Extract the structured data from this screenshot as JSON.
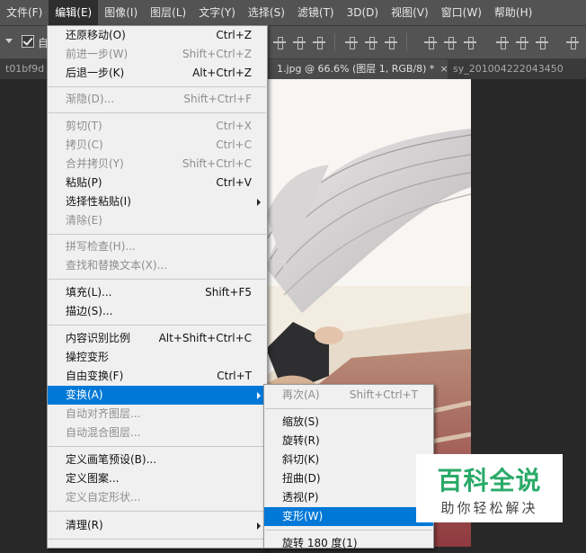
{
  "menubar": {
    "items": [
      "文件(F)",
      "编辑(E)",
      "图像(I)",
      "图层(L)",
      "文字(Y)",
      "选择(S)",
      "滤镜(T)",
      "3D(D)",
      "视图(V)",
      "窗口(W)",
      "帮助(H)"
    ],
    "active_index": 1
  },
  "options_bar": {
    "checkbox_label": "自"
  },
  "tabs": [
    {
      "label": "t01bf9d"
    },
    {
      "label": "1.jpg @ 66.6% (图层 1, RGB/8) *",
      "close": "×"
    },
    {
      "label": "sy_201004222043450"
    }
  ],
  "edit_menu": {
    "items": [
      {
        "label": "还原移动(O)",
        "shortcut": "Ctrl+Z",
        "disabled": false
      },
      {
        "label": "前进一步(W)",
        "shortcut": "Shift+Ctrl+Z",
        "disabled": true
      },
      {
        "label": "后退一步(K)",
        "shortcut": "Alt+Ctrl+Z",
        "disabled": false
      },
      {
        "label": "渐隐(D)...",
        "shortcut": "Shift+Ctrl+F",
        "disabled": true
      },
      {
        "label": "剪切(T)",
        "shortcut": "Ctrl+X",
        "disabled": true
      },
      {
        "label": "拷贝(C)",
        "shortcut": "Ctrl+C",
        "disabled": true
      },
      {
        "label": "合并拷贝(Y)",
        "shortcut": "Shift+Ctrl+C",
        "disabled": true
      },
      {
        "label": "粘贴(P)",
        "shortcut": "Ctrl+V",
        "disabled": false
      },
      {
        "label": "选择性粘贴(I)",
        "shortcut": "",
        "disabled": false,
        "submenu": true
      },
      {
        "label": "清除(E)",
        "shortcut": "",
        "disabled": true
      },
      {
        "label": "拼写检查(H)...",
        "shortcut": "",
        "disabled": true
      },
      {
        "label": "查找和替换文本(X)...",
        "shortcut": "",
        "disabled": true
      },
      {
        "label": "填充(L)...",
        "shortcut": "Shift+F5",
        "disabled": false
      },
      {
        "label": "描边(S)...",
        "shortcut": "",
        "disabled": false
      },
      {
        "label": "内容识别比例",
        "shortcut": "Alt+Shift+Ctrl+C",
        "disabled": false
      },
      {
        "label": "操控变形",
        "shortcut": "",
        "disabled": false
      },
      {
        "label": "自由变换(F)",
        "shortcut": "Ctrl+T",
        "disabled": false
      },
      {
        "label": "变换(A)",
        "shortcut": "",
        "disabled": false,
        "submenu": true,
        "highlighted": true
      },
      {
        "label": "自动对齐图层...",
        "shortcut": "",
        "disabled": true
      },
      {
        "label": "自动混合图层...",
        "shortcut": "",
        "disabled": true
      },
      {
        "label": "定义画笔预设(B)...",
        "shortcut": "",
        "disabled": false
      },
      {
        "label": "定义图案...",
        "shortcut": "",
        "disabled": false
      },
      {
        "label": "定义自定形状...",
        "shortcut": "",
        "disabled": true
      },
      {
        "label": "清理(R)",
        "shortcut": "",
        "disabled": false,
        "submenu": true
      }
    ]
  },
  "transform_menu": {
    "items": [
      {
        "label": "再次(A)",
        "shortcut": "Shift+Ctrl+T",
        "disabled": true
      },
      {
        "label": "缩放(S)",
        "shortcut": "",
        "disabled": false
      },
      {
        "label": "旋转(R)",
        "shortcut": "",
        "disabled": false
      },
      {
        "label": "斜切(K)",
        "shortcut": "",
        "disabled": false
      },
      {
        "label": "扭曲(D)",
        "shortcut": "",
        "disabled": false
      },
      {
        "label": "透视(P)",
        "shortcut": "",
        "disabled": false
      },
      {
        "label": "变形(W)",
        "shortcut": "",
        "disabled": false,
        "highlighted": true
      },
      {
        "label": "旋转 180 度(1)",
        "shortcut": "",
        "disabled": false
      }
    ]
  },
  "watermark": {
    "title": "百科全说",
    "subtitle": "助你轻松解决"
  },
  "colors": {
    "highlight": "#0078d7",
    "menu_bg": "#f0f0f0",
    "app_bg": "#282828",
    "watermark_green": "#2aaa68"
  }
}
